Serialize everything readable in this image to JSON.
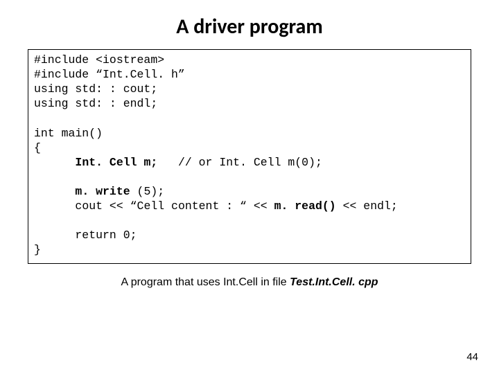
{
  "title": "A driver program",
  "code": {
    "l1": "#include <iostream>",
    "l2": "#include “Int.Cell. h”",
    "l3": "using std: : cout;",
    "l4": "using std: : endl;",
    "blank1": "",
    "l5": "int main()",
    "l6": "{",
    "l7_indent": "      ",
    "l7_b": "Int. Cell m;",
    "l7_rest": "   // or Int. Cell m(0);",
    "blank2": "",
    "l8_indent": "      ",
    "l8_b": "m. write ",
    "l8_rest": "(5);",
    "l9_indent": "      ",
    "l9_a": "cout << “Cell content : “ << ",
    "l9_b": "m. read()",
    "l9_c": " << endl;",
    "blank3": "",
    "l10": "      return 0;",
    "l11": "}"
  },
  "caption": {
    "text_a": "A program that uses Int.Cell in file ",
    "filename": "Test.Int.Cell. cpp"
  },
  "pagenum": "44"
}
